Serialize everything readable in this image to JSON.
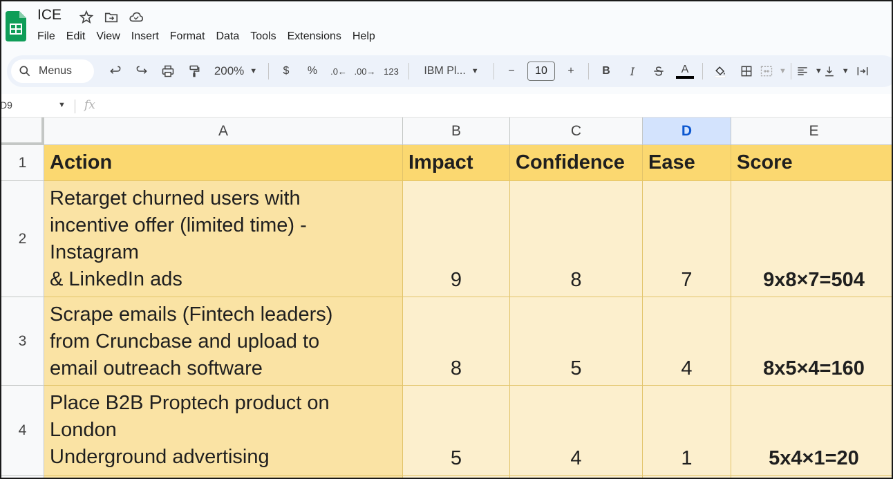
{
  "document": {
    "title": "ICE"
  },
  "menu": [
    "File",
    "Edit",
    "View",
    "Insert",
    "Format",
    "Data",
    "Tools",
    "Extensions",
    "Help"
  ],
  "toolbar": {
    "search_label": "Menus",
    "zoom": "200%",
    "currency": "$",
    "percent": "%",
    "decrease_decimal": ".0",
    "increase_decimal": ".00",
    "more_formats": "123",
    "font": "IBM Pl...",
    "font_size": "10",
    "minus": "−",
    "plus": "+",
    "bold": "B",
    "italic": "I",
    "text_color": "A"
  },
  "formula_bar": {
    "name_box": "D9",
    "fx": "fx"
  },
  "columns": [
    "A",
    "B",
    "C",
    "D",
    "E"
  ],
  "rows": [
    "1",
    "2",
    "3",
    "4"
  ],
  "table": {
    "headers": [
      "Action",
      "Impact",
      "Confidence",
      "Ease",
      "Score"
    ],
    "data": [
      {
        "action": "Retarget churned users with\nincentive offer (limited time) -\nInstagram\n& LinkedIn ads",
        "impact": "9",
        "confidence": "8",
        "ease": "7",
        "score": "9x8×7=504"
      },
      {
        "action": "Scrape emails (Fintech leaders)\nfrom Cruncbase and upload to\nemail outreach software",
        "impact": "8",
        "confidence": "5",
        "ease": "4",
        "score": "8x5×4=160"
      },
      {
        "action": "Place B2B Proptech product on\nLondon\nUnderground advertising",
        "impact": "5",
        "confidence": "4",
        "ease": "1",
        "score": "5x4×1=20"
      }
    ]
  },
  "colors": {
    "header_fill": "#fbd870",
    "action_fill": "#fae3a4",
    "value_fill": "#fcefcd",
    "selected_column": "#d3e3fd"
  }
}
